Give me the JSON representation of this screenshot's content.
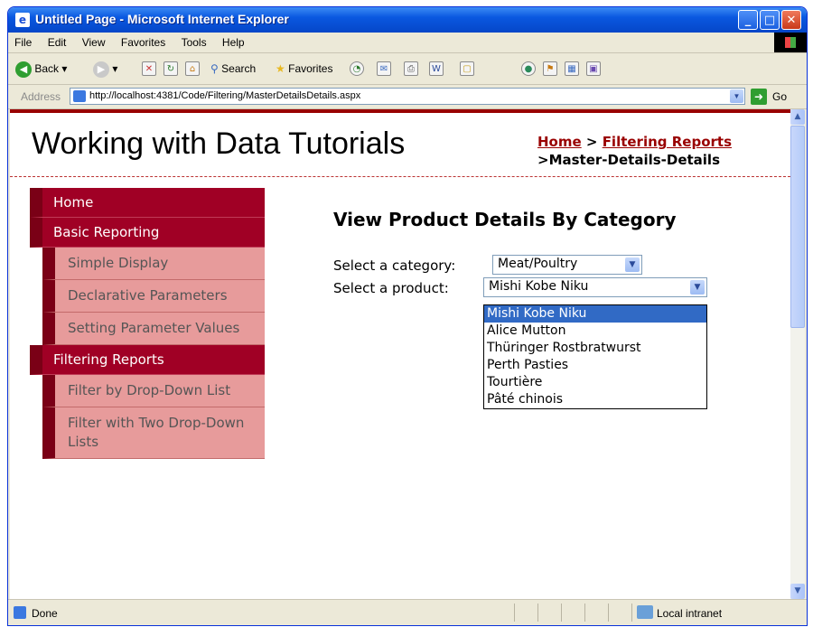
{
  "window": {
    "title": "Untitled Page - Microsoft Internet Explorer"
  },
  "menubar": {
    "items": [
      "File",
      "Edit",
      "View",
      "Favorites",
      "Tools",
      "Help"
    ]
  },
  "toolbar": {
    "back_label": "Back",
    "search_label": "Search",
    "favorites_label": "Favorites"
  },
  "address": {
    "label": "Address",
    "url": "http://localhost:4381/Code/Filtering/MasterDetailsDetails.aspx",
    "go_label": "Go"
  },
  "page": {
    "site_title": "Working with Data Tutorials",
    "breadcrumb": {
      "home": "Home",
      "sep1": " > ",
      "section": "Filtering Reports",
      "sep2": ">",
      "current": "Master-Details-Details"
    },
    "heading": "View Product Details By Category",
    "category_label": "Select a category:",
    "category_value": "Meat/Poultry",
    "product_label": "Select a product:",
    "product_value": "Mishi Kobe Niku",
    "product_options": [
      "Mishi Kobe Niku",
      "Alice Mutton",
      "Thüringer Rostbratwurst",
      "Perth Pasties",
      "Tourtière",
      "Pâté chinois"
    ],
    "selected_option_index": 0
  },
  "sidebar": {
    "items": [
      {
        "label": "Home",
        "level": "top"
      },
      {
        "label": "Basic Reporting",
        "level": "top"
      },
      {
        "label": "Simple Display",
        "level": "sub"
      },
      {
        "label": "Declarative Parameters",
        "level": "sub"
      },
      {
        "label": "Setting Parameter Values",
        "level": "sub"
      },
      {
        "label": "Filtering Reports",
        "level": "top"
      },
      {
        "label": "Filter by Drop-Down List",
        "level": "sub"
      },
      {
        "label": "Filter with Two Drop-Down Lists",
        "level": "sub"
      }
    ]
  },
  "status": {
    "text": "Done",
    "zone": "Local intranet"
  },
  "colors": {
    "accent": "#990000",
    "menu_top": "#a00025",
    "menu_sub": "#e79b9b",
    "selection": "#316ac5"
  }
}
